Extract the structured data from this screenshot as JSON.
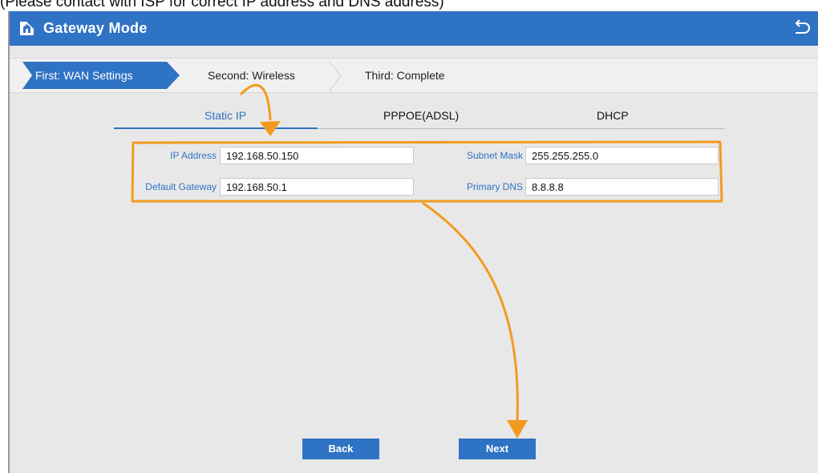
{
  "caption": "(Please contact with ISP for correct IP address and DNS address)",
  "header": {
    "title": "Gateway Mode",
    "logo_icon": "house-logo-icon",
    "back_icon": "return-arrow-icon",
    "bg_color": "#2f73c4"
  },
  "steps": [
    {
      "label": "First: WAN Settings",
      "active": true
    },
    {
      "label": "Second: Wireless",
      "active": false
    },
    {
      "label": "Third: Complete",
      "active": false
    }
  ],
  "tabs": [
    {
      "label": "Static IP",
      "active": true
    },
    {
      "label": "PPPOE(ADSL)",
      "active": false
    },
    {
      "label": "DHCP",
      "active": false
    }
  ],
  "form": {
    "ip_address": {
      "label": "IP Address",
      "value": "192.168.50.150"
    },
    "subnet_mask": {
      "label": "Subnet Mask",
      "value": "255.255.255.0"
    },
    "default_gateway": {
      "label": "Default Gateway",
      "value": "192.168.50.1"
    },
    "primary_dns": {
      "label": "Primary DNS",
      "value": "8.8.8.8"
    }
  },
  "buttons": {
    "back": "Back",
    "next": "Next"
  },
  "annotation_color": "#f39a1e"
}
